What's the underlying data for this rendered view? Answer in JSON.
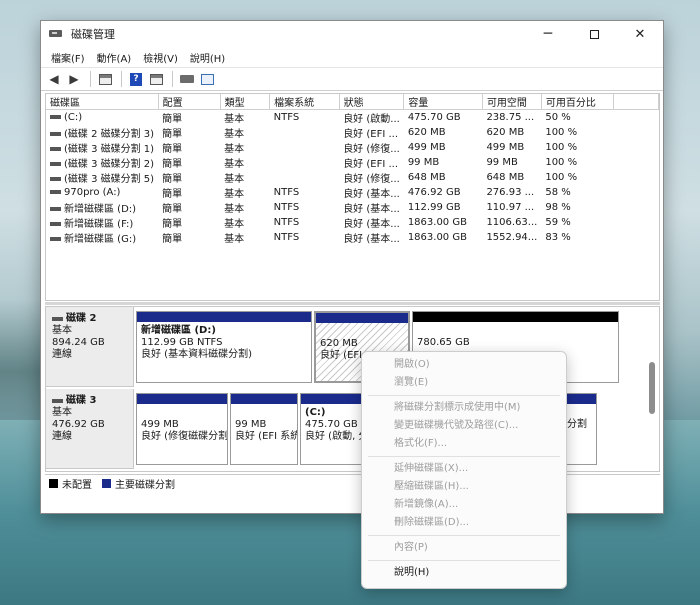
{
  "window": {
    "title": "磁碟管理"
  },
  "menu": [
    "檔案(F)",
    "動作(A)",
    "檢視(V)",
    "說明(H)"
  ],
  "volume_table": {
    "columns": [
      "磁碟區",
      "配置",
      "類型",
      "檔案系統",
      "狀態",
      "容量",
      "可用空間",
      "可用百分比"
    ],
    "rows": [
      [
        "(C:)",
        "簡單",
        "基本",
        "NTFS",
        "良好 (啟動...",
        "475.70 GB",
        "238.75 ...",
        "50 %"
      ],
      [
        "(磁碟 2 磁碟分割 3)",
        "簡單",
        "基本",
        "",
        "良好 (EFI ...",
        "620 MB",
        "620 MB",
        "100 %"
      ],
      [
        "(磁碟 3 磁碟分割 1)",
        "簡單",
        "基本",
        "",
        "良好 (修復...",
        "499 MB",
        "499 MB",
        "100 %"
      ],
      [
        "(磁碟 3 磁碟分割 2)",
        "簡單",
        "基本",
        "",
        "良好 (EFI ...",
        "99 MB",
        "99 MB",
        "100 %"
      ],
      [
        "(磁碟 3 磁碟分割 5)",
        "簡單",
        "基本",
        "",
        "良好 (修復...",
        "648 MB",
        "648 MB",
        "100 %"
      ],
      [
        "970pro (A:)",
        "簡單",
        "基本",
        "NTFS",
        "良好 (基本...",
        "476.92 GB",
        "276.93 ...",
        "58 %"
      ],
      [
        "新增磁碟區 (D:)",
        "簡單",
        "基本",
        "NTFS",
        "良好 (基本...",
        "112.99 GB",
        "110.97 ...",
        "98 %"
      ],
      [
        "新增磁碟區 (F:)",
        "簡單",
        "基本",
        "NTFS",
        "良好 (基本...",
        "1863.00 GB",
        "1106.63...",
        "59 %"
      ],
      [
        "新增磁碟區 (G:)",
        "簡單",
        "基本",
        "NTFS",
        "良好 (基本...",
        "1863.00 GB",
        "1552.94...",
        "83 %"
      ]
    ]
  },
  "disk2": {
    "name": "磁碟 2",
    "type": "基本",
    "size": "894.24 GB",
    "status": "連線",
    "partitions": [
      {
        "name": "新增磁碟區 (D:)",
        "size": "112.99 GB NTFS",
        "status": "良好 (基本資料磁碟分割)"
      },
      {
        "name": "",
        "size": "620 MB",
        "status": "良好 (EFI"
      },
      {
        "name": "",
        "size": "780.65 GB",
        "status": ""
      }
    ]
  },
  "disk3": {
    "name": "磁碟 3",
    "type": "基本",
    "size": "476.92 GB",
    "status": "連線",
    "partitions": [
      {
        "name": "",
        "size": "499 MB",
        "status": "良好 (修復磁碟分割"
      },
      {
        "name": "",
        "size": "99 MB",
        "status": "良好 (EFI 系統"
      },
      {
        "name": "(C:)",
        "size": "475.70 GB N",
        "status": "良好 (啟動, 分"
      },
      {
        "name": "",
        "size": "",
        "status": "分割"
      }
    ]
  },
  "legend": [
    {
      "label": "未配置",
      "color": "#000000"
    },
    {
      "label": "主要磁碟分割",
      "color": "#1a2b8c"
    }
  ],
  "context_menu": {
    "groups": [
      [
        {
          "label": "開啟(O)",
          "enabled": false
        },
        {
          "label": "瀏覽(E)",
          "enabled": false
        }
      ],
      [
        {
          "label": "將磁碟分割標示成使用中(M)",
          "enabled": false
        },
        {
          "label": "變更磁碟機代號及路徑(C)...",
          "enabled": false
        },
        {
          "label": "格式化(F)...",
          "enabled": false
        }
      ],
      [
        {
          "label": "延伸磁碟區(X)...",
          "enabled": false
        },
        {
          "label": "壓縮磁碟區(H)...",
          "enabled": false
        },
        {
          "label": "新增鏡像(A)...",
          "enabled": false
        },
        {
          "label": "刪除磁碟區(D)...",
          "enabled": false
        }
      ],
      [
        {
          "label": "內容(P)",
          "enabled": false
        }
      ],
      [
        {
          "label": "說明(H)",
          "enabled": true
        }
      ]
    ]
  },
  "colors": {
    "primary_partition": "#1a2b8c",
    "unallocated": "#000000"
  },
  "icons": [
    "back-icon",
    "forward-icon",
    "console-tree-icon",
    "help-icon",
    "show-hide-icon",
    "disk-icon",
    "properties-icon"
  ]
}
